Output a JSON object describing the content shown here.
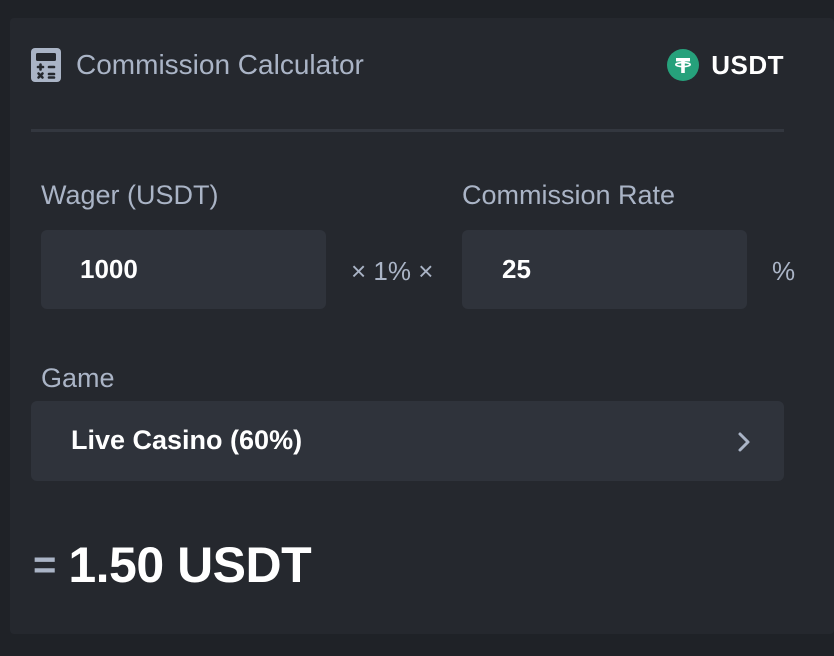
{
  "header": {
    "title": "Commission Calculator",
    "icon": "calculator-icon",
    "currency": "USDT",
    "currency_icon": "tether-icon",
    "currency_color": "#26a17b"
  },
  "wager": {
    "label": "Wager (USDT)",
    "value": "1000"
  },
  "multiplier_text": "× 1% ×",
  "commission": {
    "label": "Commission Rate",
    "value": "25",
    "unit": "%"
  },
  "game": {
    "label": "Game",
    "selected": "Live Casino (60%)",
    "icon": "chevron-right-icon"
  },
  "result": {
    "equals": "=",
    "value": "1.50 USDT"
  },
  "colors": {
    "background": "#1f2227",
    "card": "#25282e",
    "field": "#2f333b",
    "muted_text": "#aab4c6",
    "text": "#ffffff"
  }
}
